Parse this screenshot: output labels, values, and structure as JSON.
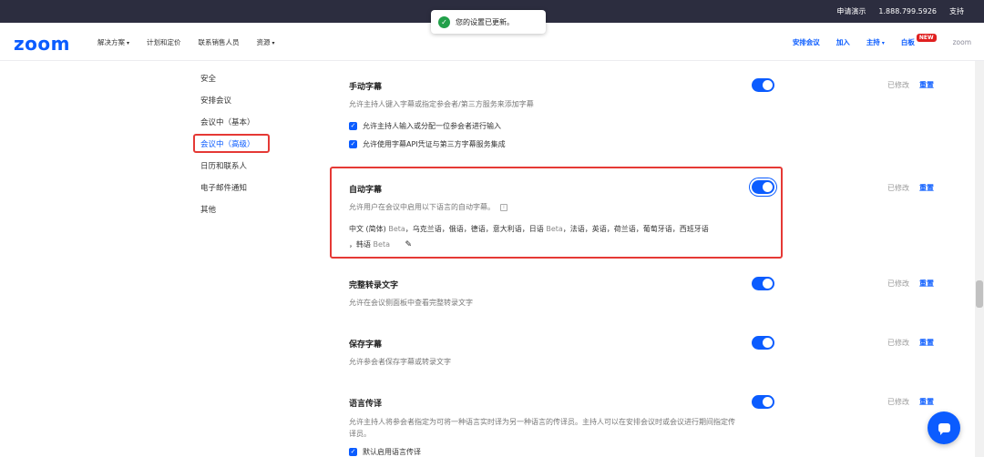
{
  "topbar": {
    "links": [
      "申请演示",
      "1.888.799.5926",
      "支持"
    ]
  },
  "nav": {
    "logo": "zoom",
    "left": [
      "解决方案",
      "计划和定价",
      "联系销售人员",
      "资源"
    ],
    "right": {
      "schedule": "安排会议",
      "join": "加入",
      "host": "主持",
      "whiteboard": "白板",
      "new_badge": "NEW",
      "zoom": "zoom"
    }
  },
  "toast": {
    "message": "您的设置已更新。"
  },
  "sidebar": {
    "items": [
      "安全",
      "安排会议",
      "会议中（基本）",
      "会议中（高级）",
      "日历和联系人",
      "电子邮件通知",
      "其他"
    ],
    "active_index": 3
  },
  "settings": {
    "modified_label": "已修改",
    "reset_label": "重置",
    "manual_caption": {
      "title": "手动字幕",
      "desc": "允许主持人键入字幕或指定参会者/第三方服务来添加字幕",
      "checks": [
        "允许主持人输入或分配一位参会者进行输入",
        "允许使用字幕API凭证与第三方字幕服务集成"
      ]
    },
    "auto_caption": {
      "title": "自动字幕",
      "desc": "允许用户在会议中启用以下语言的自动字幕。",
      "languages_line1": "中文 (简体)",
      "beta": "Beta",
      "languages_mid": "，乌克兰语，俄语，德语，意大利语，日语",
      "languages_end": "，法语，英语，荷兰语，葡萄牙语，西班牙语",
      "languages_line2": "，韩语"
    },
    "full_transcript": {
      "title": "完整转录文字",
      "desc": "允许在会议侧面板中查看完整转录文字"
    },
    "save_caption": {
      "title": "保存字幕",
      "desc": "允许参会者保存字幕或转录文字"
    },
    "interpretation": {
      "title": "语言传译",
      "desc": "允许主持人将参会者指定为可将一种语言实时译为另一种语言的传译员。主持人可以在安排会议时或会议进行期间指定传译员。",
      "check": "默认启用语言传译"
    }
  }
}
